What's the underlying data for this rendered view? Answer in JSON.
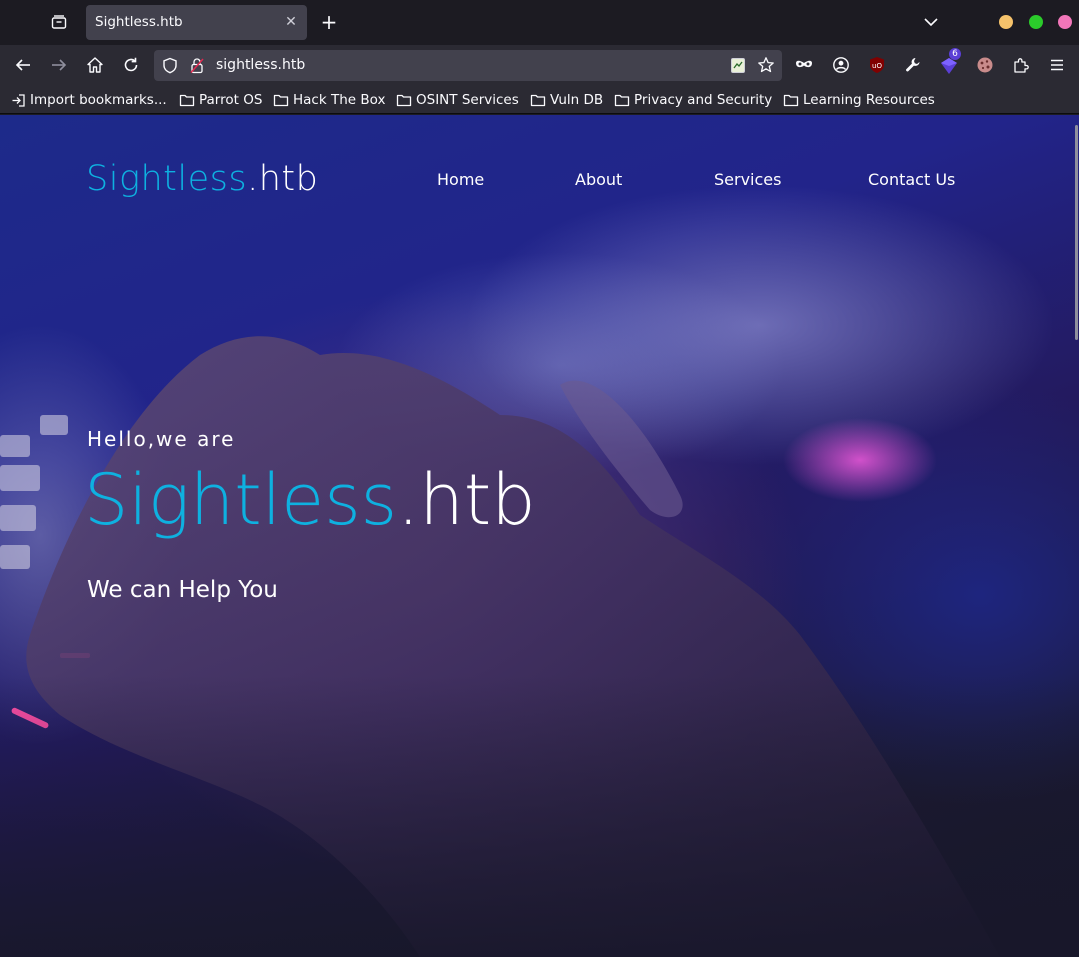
{
  "browser": {
    "tab_title": "Sightless.htb",
    "url": "sightless.htb",
    "extension_badge": "6",
    "bookmarks": [
      "Import bookmarks...",
      "Parrot OS",
      "Hack The Box",
      "OSINT Services",
      "Vuln DB",
      "Privacy and Security",
      "Learning Resources"
    ]
  },
  "site": {
    "brand_main": "Sightless",
    "brand_suffix": ".htb",
    "nav": [
      "Home",
      "About",
      "Services",
      "Contact Us"
    ],
    "hero_pre": "Hello,we are",
    "hero_title_main": "Sightless",
    "hero_title_suffix": ".htb",
    "hero_sub": "We can Help You"
  },
  "colors": {
    "accent": "#0eb1e0",
    "chrome_bg": "#1c1b22",
    "toolbar_bg": "#2b2a33",
    "field_bg": "#42414d"
  }
}
